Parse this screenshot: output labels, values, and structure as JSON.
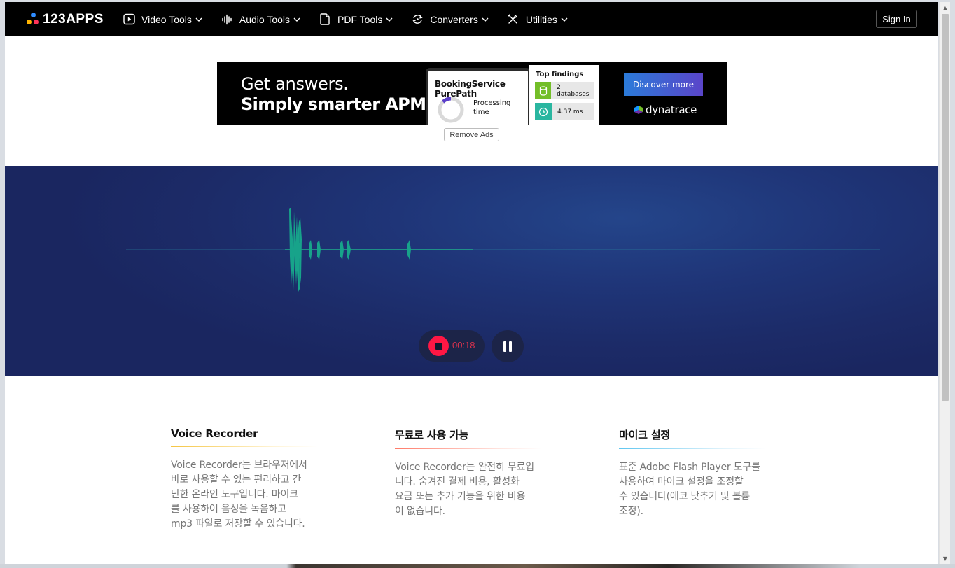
{
  "header": {
    "logo_text": "123APPS",
    "nav": [
      {
        "label": "Video Tools",
        "icon": "play-icon"
      },
      {
        "label": "Audio Tools",
        "icon": "audio-wave-icon"
      },
      {
        "label": "PDF Tools",
        "icon": "document-icon"
      },
      {
        "label": "Converters",
        "icon": "convert-icon"
      },
      {
        "label": "Utilities",
        "icon": "tools-icon"
      }
    ],
    "signin_label": "Sign In"
  },
  "ad": {
    "line1": "Get answers.",
    "line2": "Simply smarter APM.",
    "card_title": "BookingService PurePath",
    "processing_line1": "Processing",
    "processing_line2": "time",
    "findings_title": "Top findings",
    "finding1": "2 databases",
    "finding2": "4.37 ms",
    "cta": "Discover more",
    "brand": "dynatrace",
    "remove_ads": "Remove Ads"
  },
  "recorder": {
    "timer": "00:18",
    "state": "recording",
    "colors": {
      "accent": "#ff1744",
      "wave": "#17a38a",
      "background": "#1f3578"
    }
  },
  "features": [
    {
      "title": "Voice Recorder",
      "lines": [
        "Voice Recorder는 브라우저에서",
        "바로 사용할 수 있는 편리하고 간",
        "단한 온라인 도구입니다. 마이크",
        "를 사용하여 음성을 녹음하고",
        "mp3 파일로 저장할 수 있습니다."
      ]
    },
    {
      "title": "무료로 사용 가능",
      "lines": [
        "Voice Recorder는 완전히 무료입",
        "니다. 숨겨진 결제 비용, 활성화",
        "요금 또는 추가 기능을 위한 비용",
        "이 없습니다."
      ]
    },
    {
      "title": "마이크 설정",
      "lines": [
        "표준 Adobe Flash Player 도구를",
        "사용하여 마이크 설정을 조정할",
        "수 있습니다(에코 낮추기 및 볼륨",
        "조정)."
      ]
    }
  ]
}
